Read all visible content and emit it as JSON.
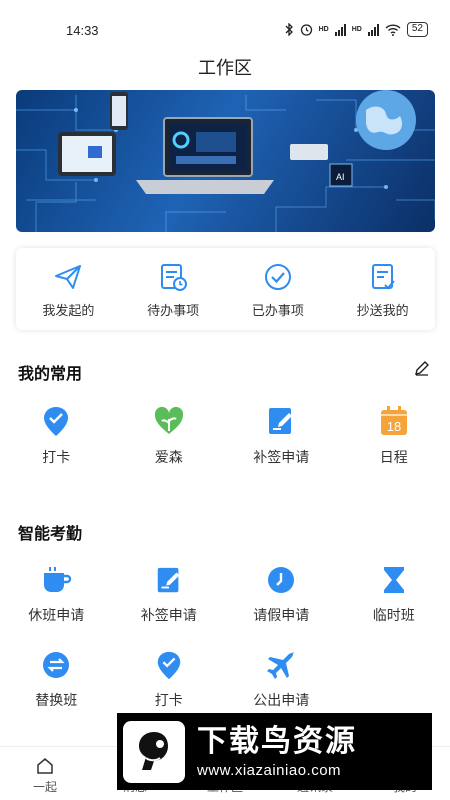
{
  "status": {
    "time": "14:33",
    "battery": "52",
    "hd1": "HD",
    "hd2": "HD"
  },
  "header": {
    "title": "工作区"
  },
  "quick": [
    {
      "icon": "send-icon",
      "label": "我发起的"
    },
    {
      "icon": "todo-icon",
      "label": "待办事项"
    },
    {
      "icon": "done-icon",
      "label": "已办事项"
    },
    {
      "icon": "cc-icon",
      "label": "抄送我的"
    }
  ],
  "favorites": {
    "title": "我的常用",
    "items": [
      {
        "icon": "location-check-icon",
        "label": "打卡"
      },
      {
        "icon": "heart-sprout-icon",
        "label": "爱森"
      },
      {
        "icon": "edit-note-icon",
        "label": "补签申请"
      },
      {
        "icon": "calendar-icon",
        "label": "日程",
        "date": "18"
      }
    ]
  },
  "attendance": {
    "title": "智能考勤",
    "row1": [
      {
        "icon": "coffee-icon",
        "label": "休班申请"
      },
      {
        "icon": "edit-note-icon",
        "label": "补签申请"
      },
      {
        "icon": "clock-icon",
        "label": "请假申请"
      },
      {
        "icon": "hourglass-icon",
        "label": "临时班"
      }
    ],
    "row2": [
      {
        "icon": "swap-icon",
        "label": "替换班"
      },
      {
        "icon": "location-check-icon",
        "label": "打卡"
      },
      {
        "icon": "airplane-icon",
        "label": "公出申请"
      }
    ]
  },
  "tabbar": [
    {
      "icon": "home-icon",
      "label": "一起"
    },
    {
      "label": "消息"
    },
    {
      "label": "工作区"
    },
    {
      "label": "通讯录"
    },
    {
      "label": "我的"
    }
  ],
  "watermark": {
    "title": "下载鸟资源",
    "url": "www.xiazainiao.com"
  },
  "colors": {
    "accent": "#2f8cf0",
    "green": "#5bbd5a",
    "orange": "#f4a43a"
  }
}
